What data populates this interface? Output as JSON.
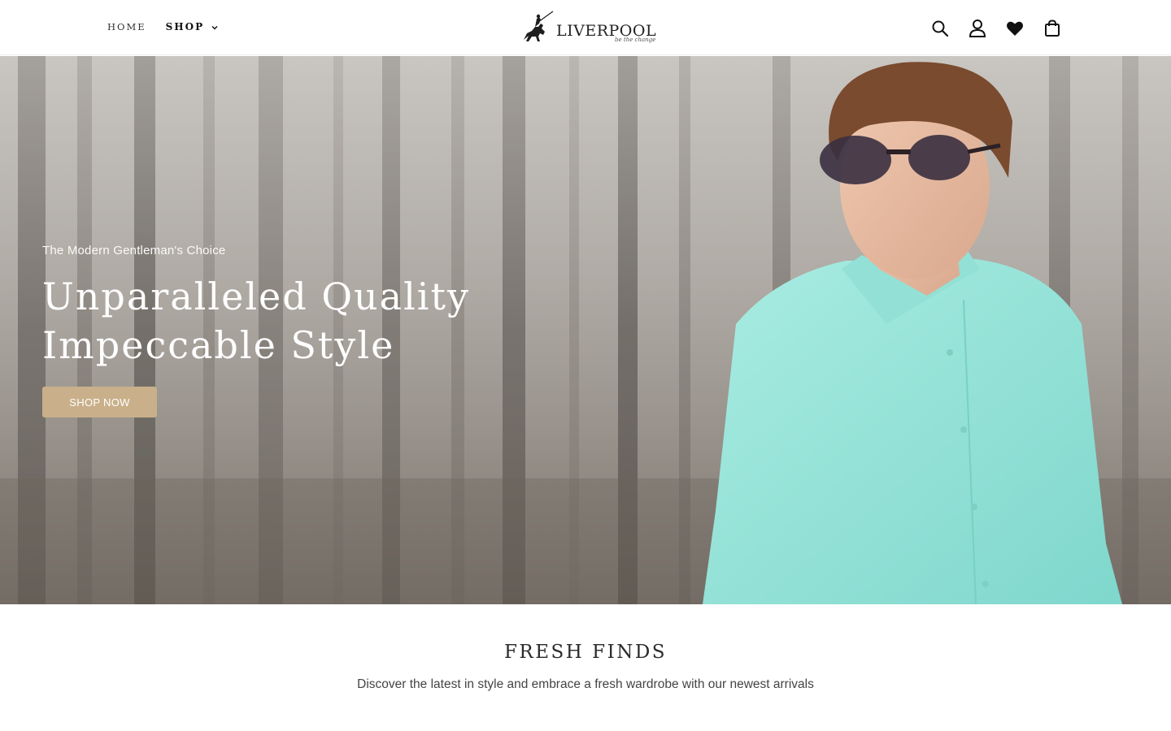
{
  "header": {
    "nav": {
      "home_label": "HOME",
      "shop_label": "SHOP"
    },
    "logo": {
      "name": "LIVERPOOL",
      "tagline": "be the change"
    },
    "icons": [
      "search-icon",
      "account-icon",
      "wishlist-heart-icon",
      "cart-bag-icon"
    ]
  },
  "hero": {
    "subtitle": "The Modern Gentleman's Choice",
    "title_line1": "Unparalleled Quality",
    "title_line2": "Impeccable Style",
    "cta_label": "SHOP NOW",
    "cta_color": "#c9b08a"
  },
  "fresh_finds": {
    "title": "FRESH FINDS",
    "description": "Discover the latest in style and embrace a fresh wardrobe with our newest arrivals"
  }
}
